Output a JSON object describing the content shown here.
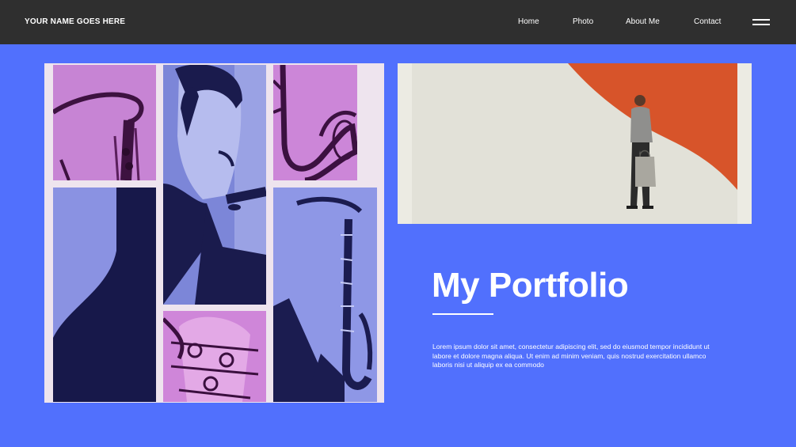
{
  "header": {
    "brand": "YOUR NAME GOES HERE",
    "nav": [
      "Home",
      "Photo",
      "About Me",
      "Contact"
    ],
    "menu_icon": "hamburger-icon"
  },
  "hero": {
    "title": "My Portfolio",
    "body": "Lorem ipsum dolor sit amet, consectetur adipiscing elit, sed do eiusmod tempor incididunt ut labore et dolore magna aliqua. Ut enim ad minim veniam, quis nostrud exercitation ullamco laboris nisi ut aliquip ex ea commodo"
  },
  "colors": {
    "page_background": "#5170fd",
    "header_background": "#2f2f2f",
    "collage_pink": "#c97ed6",
    "collage_blue": "#8b93e6",
    "collage_navy": "#17184a",
    "artwork_red": "#d7542a",
    "artwork_paper": "#e5e3da"
  }
}
